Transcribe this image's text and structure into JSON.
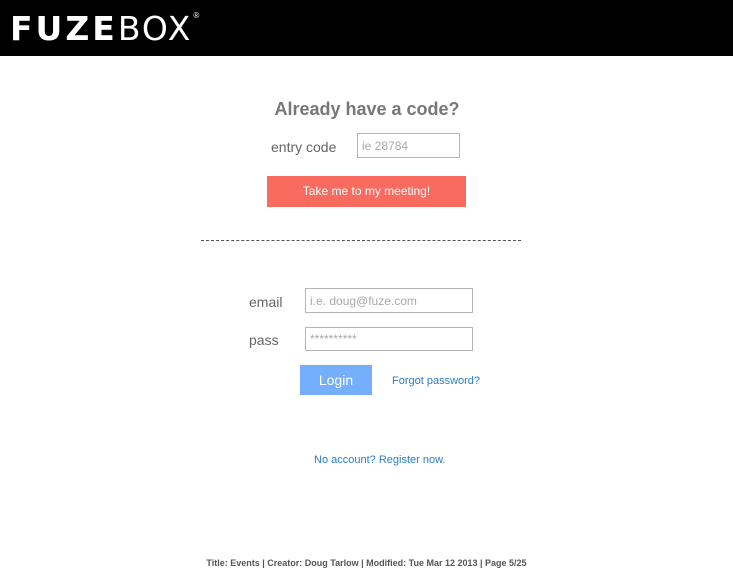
{
  "header": {
    "logo_bold": "FUZE",
    "logo_light": "BOX",
    "logo_mark": "®"
  },
  "code_section": {
    "heading": "Already have a code?",
    "entry_label": "entry code",
    "entry_placeholder": "ie 28784",
    "submit_label": "Take me to my meeting!"
  },
  "login_section": {
    "email_label": "email",
    "email_placeholder": "i.e. doug@fuze.com",
    "pass_label": "pass",
    "pass_placeholder": "**********",
    "login_label": "Login",
    "forgot_label": "Forgot password?"
  },
  "register_link": "No account? Register now.",
  "footer": "Title: Events  |  Creator: Doug Tarlow  |  Modified: Tue Mar 12 2013  |  Page 5/25",
  "colors": {
    "header_bg": "#000000",
    "meeting_button": "#f96a5f",
    "login_button": "#75aefb",
    "link": "#2a7ec4"
  }
}
